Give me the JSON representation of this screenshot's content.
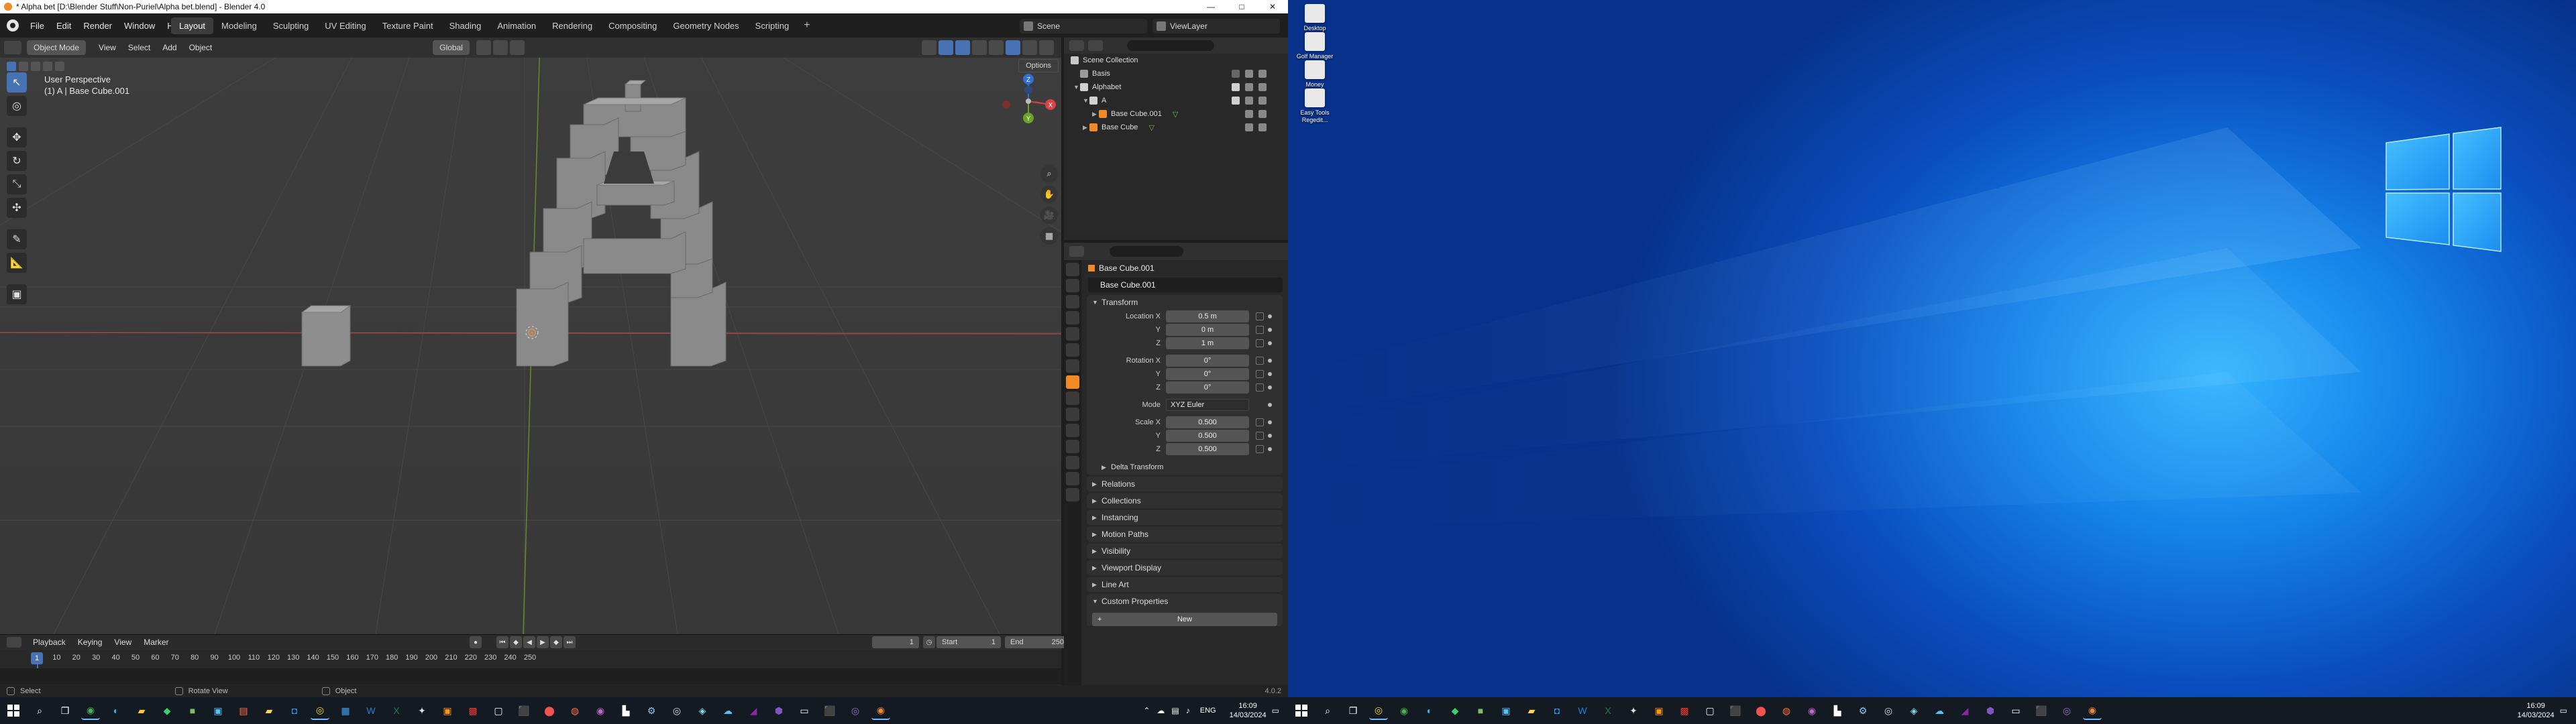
{
  "blender": {
    "window_title": "* Alpha bet [D:\\Blender Stuff\\Non-Puriel\\Alpha bet.blend] - Blender 4.0",
    "window_buttons": [
      "—",
      "□",
      "✕"
    ],
    "menu": [
      "File",
      "Edit",
      "Render",
      "Window",
      "Help"
    ],
    "workspaces": [
      "Layout",
      "Modeling",
      "Sculpting",
      "UV Editing",
      "Texture Paint",
      "Shading",
      "Animation",
      "Rendering",
      "Compositing",
      "Geometry Nodes",
      "Scripting"
    ],
    "active_workspace": "Layout",
    "workspace_add": "+",
    "scene": "Scene",
    "view_layer": "ViewLayer",
    "viewport": {
      "mode": "Object Mode",
      "menu": [
        "View",
        "Select",
        "Add",
        "Object"
      ],
      "orientation": "Global",
      "options": "Options",
      "info_line1": "User Perspective",
      "info_line2": "(1) A | Base Cube.001",
      "gizmo": {
        "x": "X",
        "y": "Y",
        "z": "Z"
      }
    },
    "timeline": {
      "menu": [
        "Playback",
        "Keying",
        "View",
        "Marker"
      ],
      "current_frame": "1",
      "start_label": "Start",
      "start": "1",
      "end_label": "End",
      "end": "250",
      "ruler": [
        "0",
        "10",
        "20",
        "30",
        "40",
        "50",
        "60",
        "70",
        "80",
        "90",
        "100",
        "110",
        "120",
        "130",
        "140",
        "150",
        "160",
        "170",
        "180",
        "190",
        "200",
        "210",
        "220",
        "230",
        "240",
        "250"
      ]
    },
    "status": {
      "select": "Select",
      "rotate": "Rotate View",
      "object": "Object",
      "version": "4.0.2"
    },
    "outliner": {
      "rows": [
        {
          "name": "Scene Collection",
          "indent": 0
        },
        {
          "name": "Basis",
          "indent": 1
        },
        {
          "name": "Alphabet",
          "indent": 1
        },
        {
          "name": "A",
          "indent": 2
        },
        {
          "name": "Base Cube.001",
          "indent": 3
        },
        {
          "name": "Base Cube",
          "indent": 2
        }
      ]
    },
    "properties": {
      "object_name": "Base Cube.001",
      "name_field": "Base Cube.001",
      "transform_title": "Transform",
      "location": {
        "label": "Location X",
        "x": "0.5 m",
        "y": "0 m",
        "z": "1 m"
      },
      "rotation": {
        "label": "Rotation X",
        "x": "0°",
        "y": "0°",
        "z": "0°"
      },
      "mode_label": "Mode",
      "mode": "XYZ Euler",
      "scale": {
        "label": "Scale X",
        "x": "0.500",
        "y": "0.500",
        "z": "0.500"
      },
      "axis_y": "Y",
      "axis_z": "Z",
      "delta_transform": "Delta Transform",
      "panels": [
        "Relations",
        "Collections",
        "Instancing",
        "Motion Paths",
        "Visibility",
        "Viewport Display",
        "Line Art"
      ],
      "custom_properties": "Custom Properties",
      "new_button": "New"
    }
  },
  "desktop": {
    "icons": [
      "Desktop",
      "Golf Manager",
      "Money",
      "Easy Tools Regedit..."
    ],
    "clock_time": "16:09",
    "clock_date": "14/03/2024",
    "clock_time2": "16:09",
    "clock_date2": "14/03/2024",
    "lang": "ENG"
  },
  "colors": {
    "accent": "#4772b3",
    "blender_bg": "#3d3d3d",
    "desktop_blue": "#1481e8",
    "active_orange": "#f08a24"
  }
}
